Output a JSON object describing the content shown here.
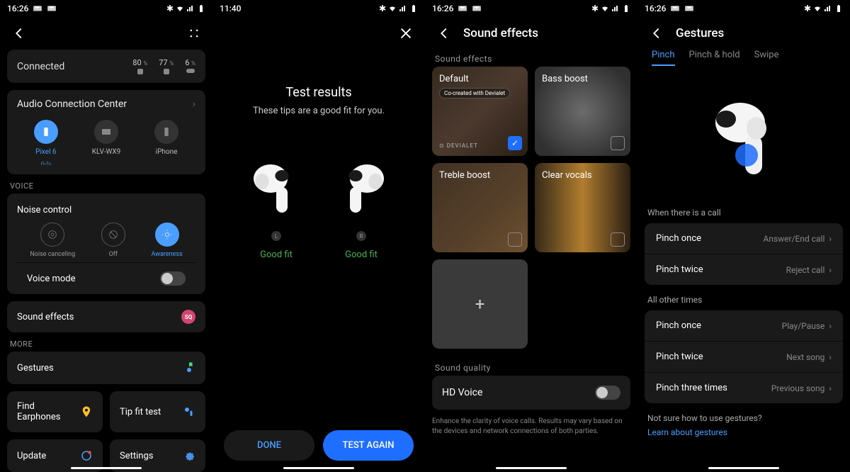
{
  "status": {
    "time_a": "16:26",
    "time_b": "11:40",
    "bt": "✱",
    "wifi": "▾",
    "sig": "▴",
    "batt": "▮"
  },
  "s1": {
    "connected": "Connected",
    "battery": {
      "left": "80",
      "right": "77",
      "case": "6",
      "pct": "%"
    },
    "acc_title": "Audio Connection Center",
    "devices": [
      {
        "name": "Pixel 6"
      },
      {
        "name": "KLV-WX9"
      },
      {
        "name": "iPhone"
      }
    ],
    "voice_label": "VOICE",
    "noise_title": "Noise control",
    "noise": [
      {
        "name": "Noise canceling"
      },
      {
        "name": "Off"
      },
      {
        "name": "Awareness"
      }
    ],
    "voice_mode": "Voice mode",
    "sound_effects": "Sound effects",
    "sq": "SQ",
    "more_label": "MORE",
    "tiles": {
      "gestures": "Gestures",
      "find": "Find Earphones",
      "tipfit": "Tip fit test",
      "update": "Update",
      "settings": "Settings"
    }
  },
  "s2": {
    "title": "Test results",
    "subtitle": "These tips are a good fit for you.",
    "left_label": "L",
    "right_label": "R",
    "good_fit": "Good fit",
    "done": "DONE",
    "test_again": "TEST AGAIN"
  },
  "s3": {
    "title": "Sound effects",
    "section": "Sound effects",
    "presets": {
      "default": "Default",
      "default_tag": "Co-created with Devialet",
      "bass": "Bass boost",
      "treble": "Treble boost",
      "clear": "Clear vocals",
      "devialet": "⊙ DEVIALET"
    },
    "sq_label": "Sound quality",
    "hd_voice": "HD Voice",
    "hd_desc": "Enhance the clarity of voice calls. Results may vary based on the devices and network connections of both parties."
  },
  "s4": {
    "title": "Gestures",
    "tabs": {
      "pinch": "Pinch",
      "hold": "Pinch & hold",
      "swipe": "Swipe"
    },
    "call_label": "When there is a call",
    "call_rows": [
      {
        "label": "Pinch once",
        "val": "Answer/End call"
      },
      {
        "label": "Pinch twice",
        "val": "Reject call"
      }
    ],
    "other_label": "All other times",
    "other_rows": [
      {
        "label": "Pinch once",
        "val": "Play/Pause"
      },
      {
        "label": "Pinch twice",
        "val": "Next song"
      },
      {
        "label": "Pinch three times",
        "val": "Previous song"
      }
    ],
    "help": "Not sure how to use gestures?",
    "link": "Learn about gestures"
  }
}
